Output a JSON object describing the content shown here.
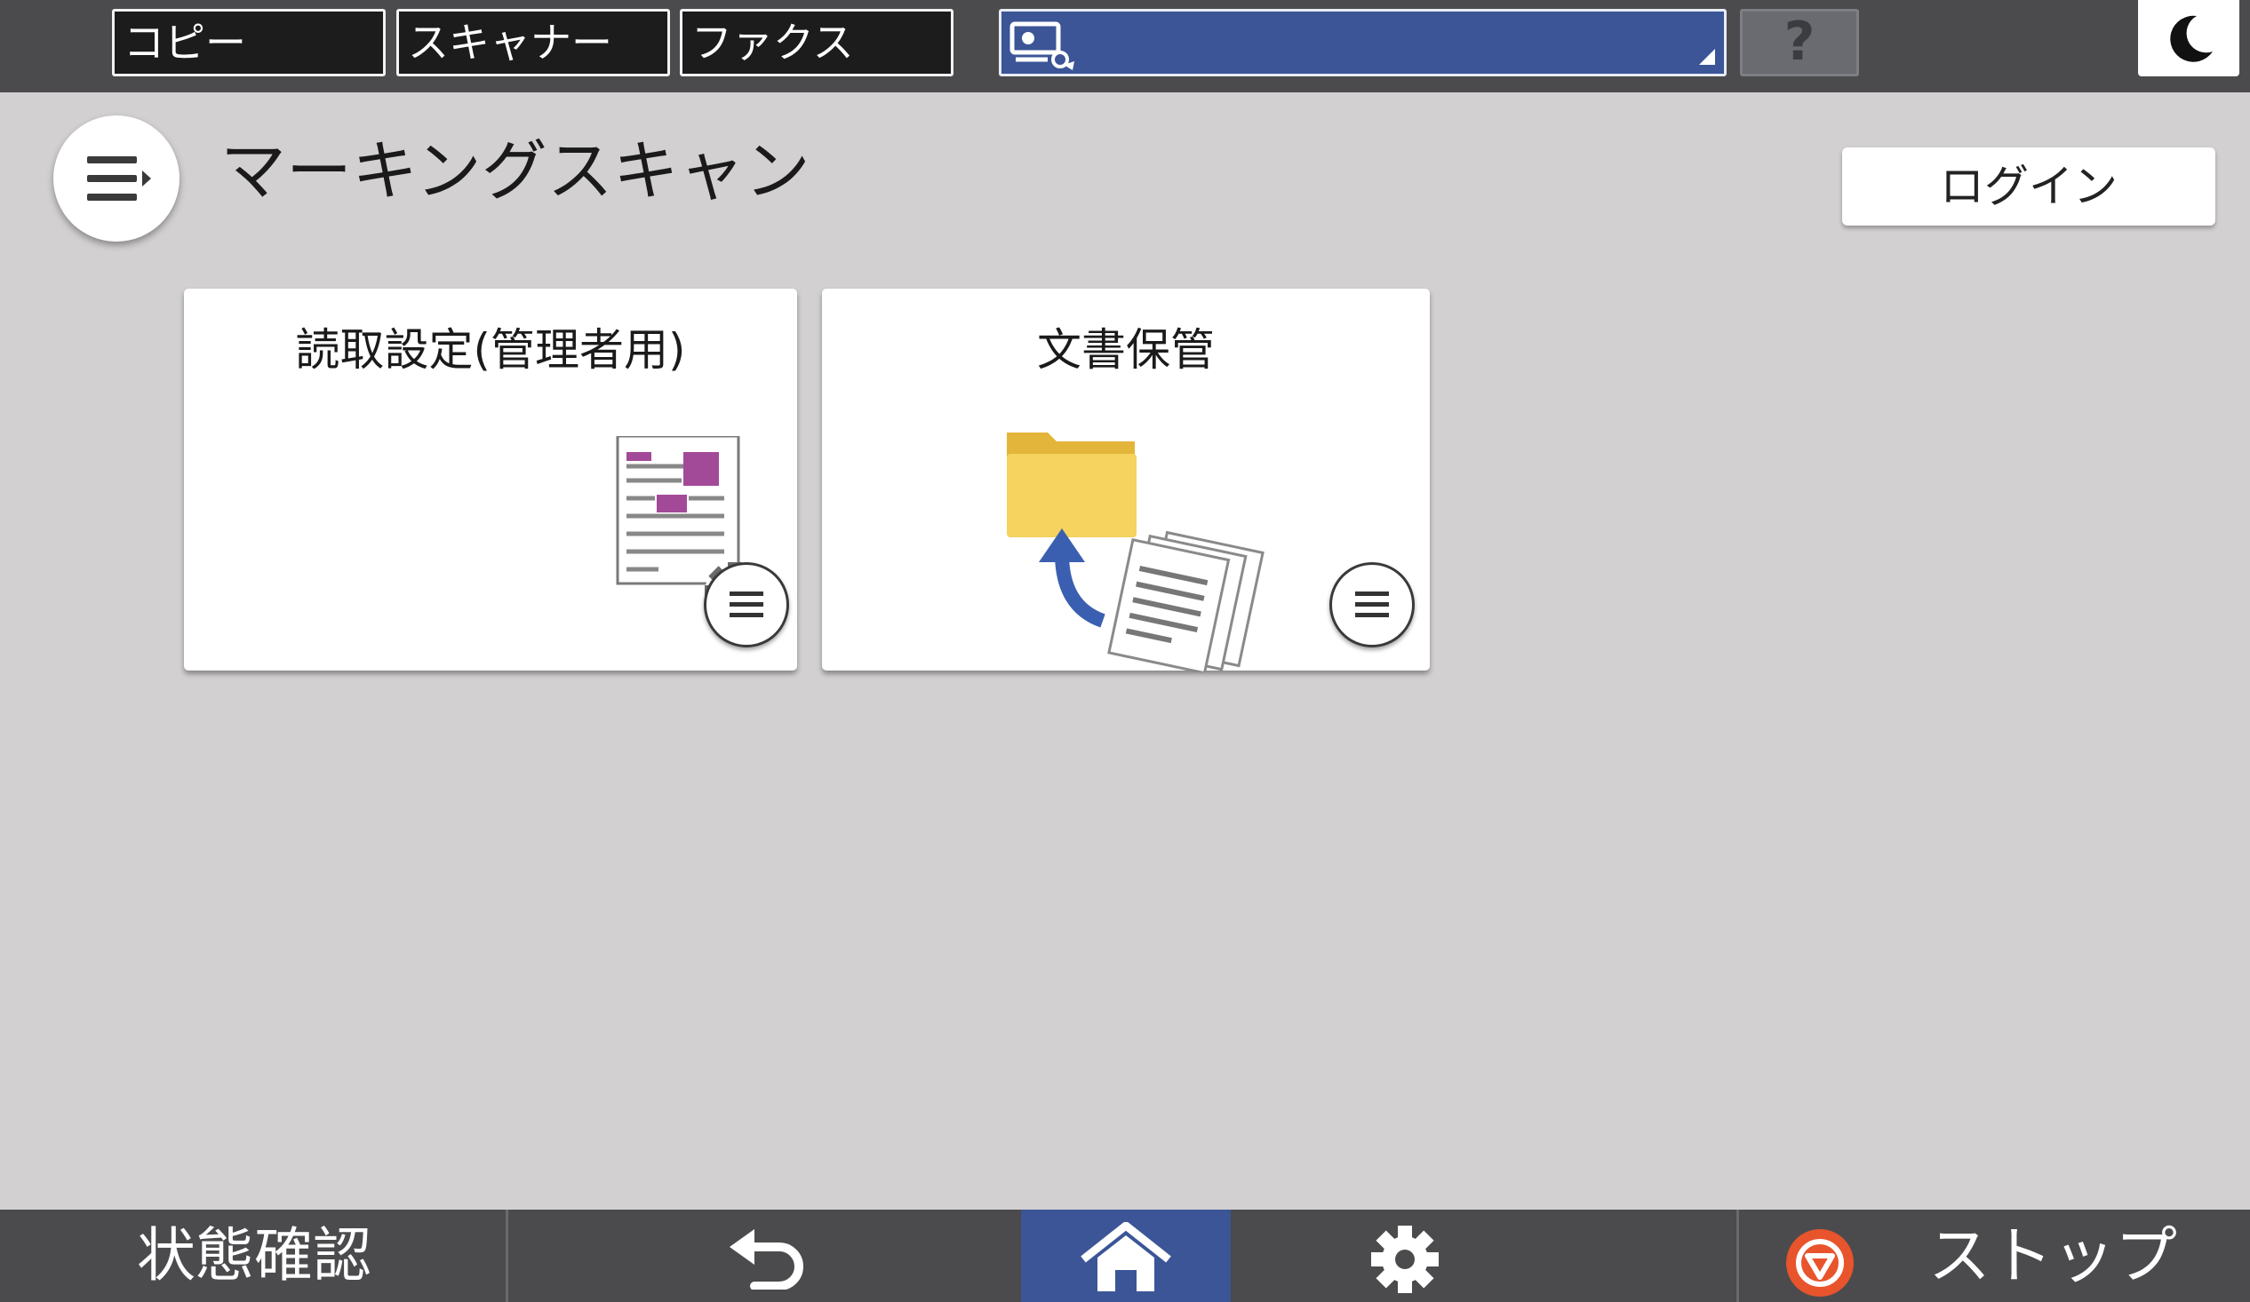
{
  "top_bar": {
    "tabs": [
      {
        "label": "コピー"
      },
      {
        "label": "スキャナー"
      },
      {
        "label": "ファクス"
      }
    ],
    "job_dropdown_icon": "scan-to-icon",
    "help_label": "?",
    "sleep_icon": "moon-icon"
  },
  "header": {
    "title": "マーキングスキャン",
    "login_label": "ログイン",
    "menu_icon": "menu-list-icon"
  },
  "tiles": [
    {
      "label": "読取設定(管理者用)",
      "icon": "document-settings-icon"
    },
    {
      "label": "文書保管",
      "icon": "folder-upload-icon"
    }
  ],
  "bottom_bar": {
    "status_label": "状態確認",
    "stop_label": "ストップ",
    "back_icon": "back-arrow-icon",
    "home_icon": "home-icon",
    "settings_icon": "gear-icon"
  },
  "colors": {
    "accent_blue": "#3b5597",
    "bar_gray": "#4b4b4d",
    "background": "#d2d0d1",
    "stop_orange": "#e8542c",
    "marking_magenta": "#a24a98"
  }
}
